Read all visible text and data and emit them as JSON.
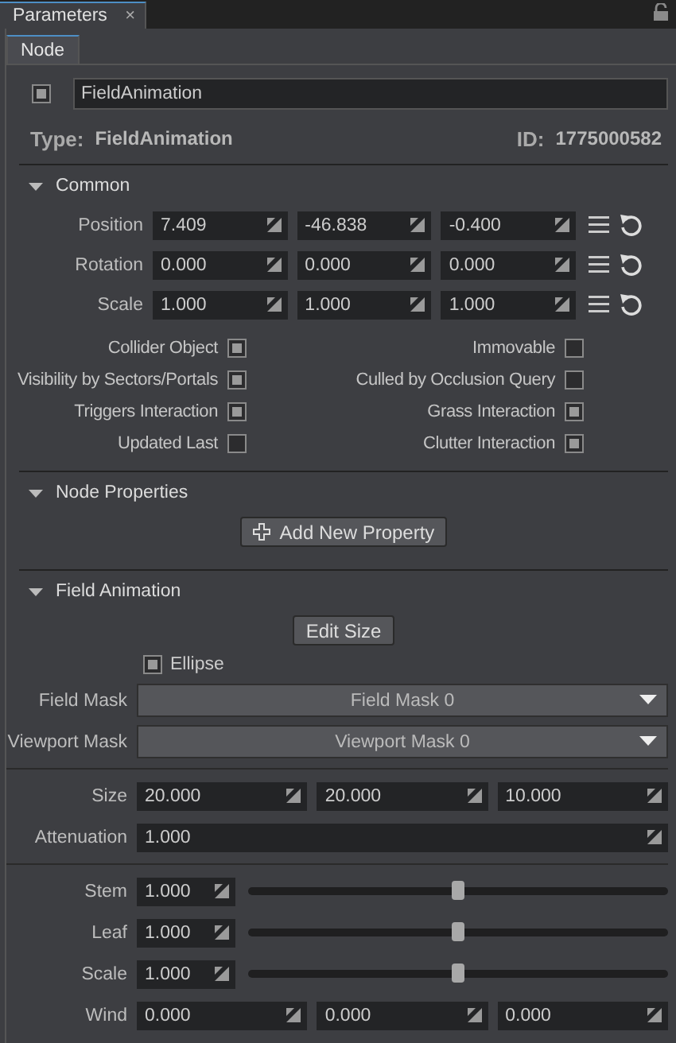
{
  "panel_tab": {
    "title": "Parameters",
    "close": "×"
  },
  "node_tab": {
    "label": "Node",
    "selected": true
  },
  "node": {
    "enabled": true,
    "name": "FieldAnimation",
    "type_label": "Type:",
    "type": "FieldAnimation",
    "id_label": "ID:",
    "id": "1775000582"
  },
  "sections": [
    {
      "kind": "common",
      "title": "Common",
      "expanded": true,
      "vectors": [
        {
          "label": "Position",
          "values": [
            "7.409",
            "-46.838",
            "-0.400"
          ]
        },
        {
          "label": "Rotation",
          "values": [
            "0.000",
            "0.000",
            "0.000"
          ]
        },
        {
          "label": "Scale",
          "values": [
            "1.000",
            "1.000",
            "1.000"
          ]
        }
      ],
      "flags": [
        {
          "label": "Collider Object",
          "checked": true
        },
        {
          "label": "Immovable",
          "checked": false
        },
        {
          "label": "Visibility by Sectors/Portals",
          "checked": true
        },
        {
          "label": "Culled by Occlusion Query",
          "checked": false
        },
        {
          "label": "Triggers Interaction",
          "checked": true
        },
        {
          "label": "Grass Interaction",
          "checked": true
        },
        {
          "label": "Updated Last",
          "checked": false
        },
        {
          "label": "Clutter Interaction",
          "checked": true
        }
      ]
    },
    {
      "kind": "properties",
      "title": "Node Properties",
      "expanded": true,
      "button": "Add New Property"
    },
    {
      "kind": "field",
      "title": "Field Animation",
      "expanded": true,
      "button": "Edit Size",
      "ellipse": {
        "label": "Ellipse",
        "checked": true
      },
      "masks": [
        {
          "label": "Field Mask",
          "value": "Field Mask 0"
        },
        {
          "label": "Viewport Mask",
          "value": "Viewport Mask 0"
        }
      ],
      "groups": [
        [
          {
            "kind": "vector",
            "label": "Size",
            "values": [
              "20.000",
              "20.000",
              "10.000"
            ]
          },
          {
            "kind": "scalar",
            "label": "Attenuation",
            "value": "1.000"
          }
        ],
        [
          {
            "kind": "slider",
            "label": "Stem",
            "value": "1.000",
            "level": 0.5
          },
          {
            "kind": "slider",
            "label": "Leaf",
            "value": "1.000",
            "level": 0.5
          },
          {
            "kind": "slider",
            "label": "Scale",
            "value": "1.000",
            "level": 0.5
          },
          {
            "kind": "vector",
            "label": "Wind",
            "values": [
              "0.000",
              "0.000",
              "0.000"
            ]
          }
        ]
      ]
    }
  ]
}
